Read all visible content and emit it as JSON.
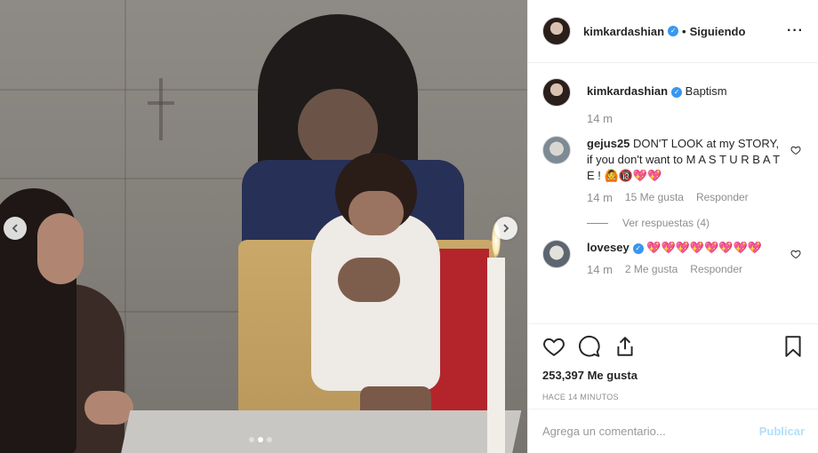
{
  "header": {
    "username": "kimkardashian",
    "separator": "•",
    "follow_label": "Siguiendo",
    "more_label": "···"
  },
  "caption": {
    "username": "kimkardashian",
    "text": "Baptism",
    "time": "14 m"
  },
  "comments": [
    {
      "username": "gejus25",
      "text": "DON'T LOOK at my STORY, if you don't want to M A S T U R B A T E ! 🙆🔞💖💖",
      "time": "14 m",
      "likes": "15 Me gusta",
      "reply_label": "Responder",
      "view_replies": "Ver respuestas (4)"
    },
    {
      "username": "lovesey",
      "text": "💖💖💖💖💖💖💖💖",
      "time": "14 m",
      "likes": "2 Me gusta",
      "reply_label": "Responder"
    }
  ],
  "stats": {
    "likes": "253,397 Me gusta",
    "posted": "HACE 14 MINUTOS"
  },
  "composer": {
    "placeholder": "Agrega un comentario...",
    "publish_label": "Publicar"
  },
  "carousel": {
    "total": 3,
    "active": 2
  },
  "colors": {
    "verified": "#3897f0",
    "publish_disabled": "#b2dffc",
    "border": "#efefef",
    "secondary_text": "#8e8e8e"
  },
  "icons": [
    "chevron-left-icon",
    "chevron-right-icon",
    "verified-icon",
    "more-icon",
    "heart-icon",
    "comment-icon",
    "share-icon",
    "bookmark-icon"
  ]
}
